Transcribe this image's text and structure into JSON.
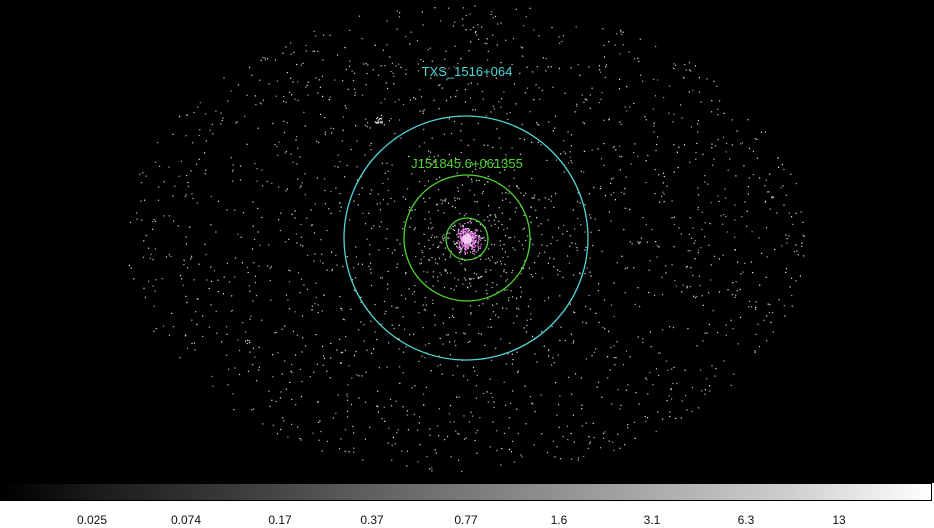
{
  "regions": [
    {
      "label": "TXS_1516+064",
      "color": "#4fd6d6"
    },
    {
      "label": "J151845.6+061355",
      "color": "#4fd630"
    }
  ],
  "colorbar": {
    "ticks": [
      "0.025",
      "0.074",
      "0.17",
      "0.37",
      "0.77",
      "1.6",
      "3.1",
      "6.3",
      "13"
    ]
  },
  "colors": {
    "background": "#000000",
    "source_core": "#e070e0",
    "noise": "#d8d8d8"
  }
}
